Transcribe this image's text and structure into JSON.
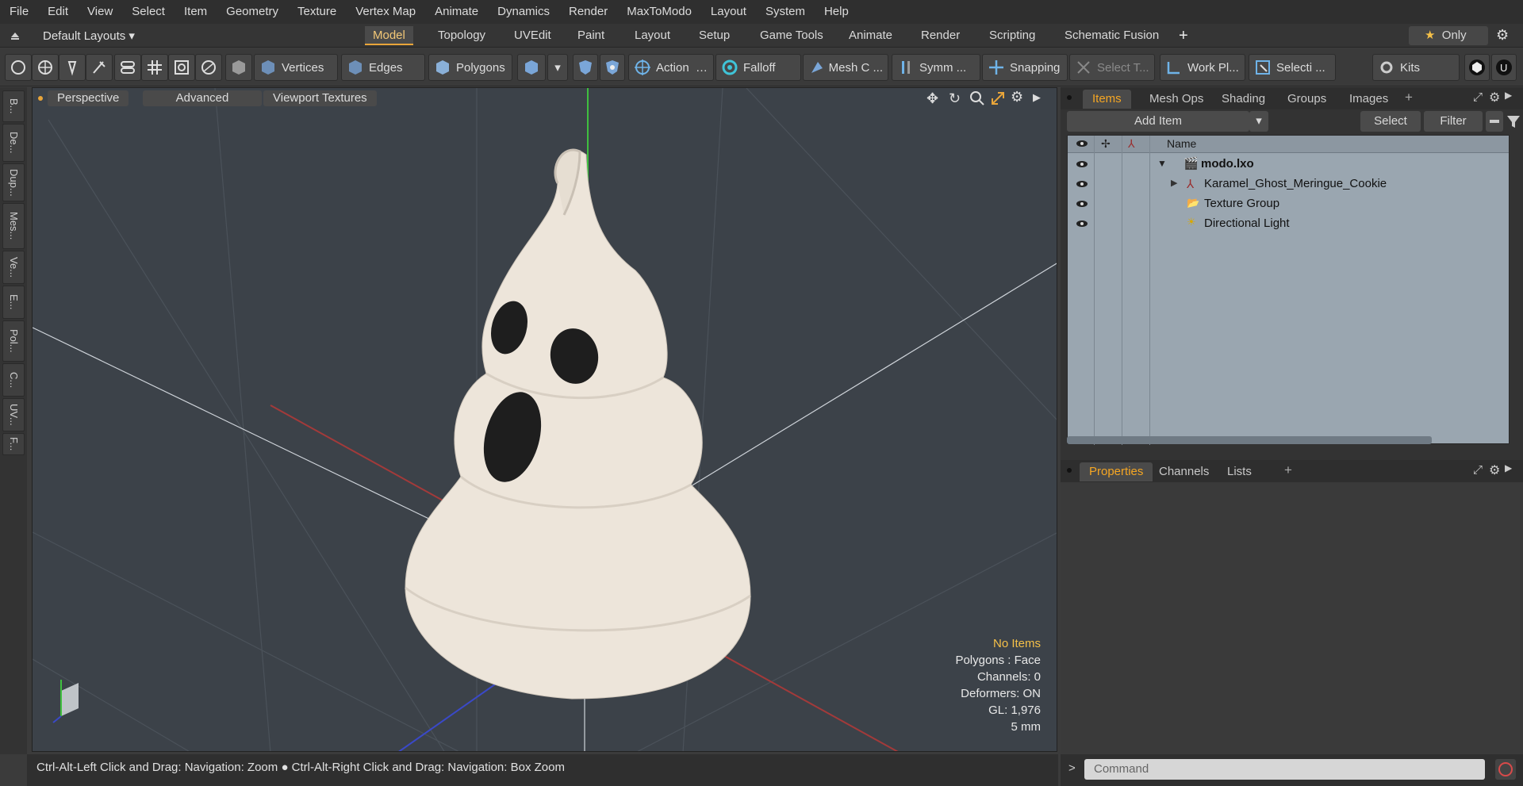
{
  "menu": [
    "File",
    "Edit",
    "View",
    "Select",
    "Item",
    "Geometry",
    "Texture",
    "Vertex Map",
    "Animate",
    "Dynamics",
    "Render",
    "MaxToModo",
    "Layout",
    "System",
    "Help"
  ],
  "layout_bar": {
    "layouts_label": "Default Layouts",
    "tabs": [
      "Model",
      "Topology",
      "UVEdit",
      "Paint",
      "Layout",
      "Setup",
      "Game Tools",
      "Animate",
      "Render",
      "Scripting",
      "Schematic Fusion"
    ],
    "active_tab": "Model",
    "only_label": "Only"
  },
  "toolbar": {
    "vertices": "Vertices",
    "edges": "Edges",
    "polygons": "Polygons",
    "action": "Action",
    "falloff": "Falloff",
    "mesh": "Mesh C ...",
    "symm": "Symm ...",
    "snapping": "Snapping",
    "select_t": "Select T...",
    "work_pl": "Work Pl...",
    "selecti": "Selecti ...",
    "kits": "Kits"
  },
  "left_tabs": [
    "B...",
    "De...",
    "Dup...",
    "Mes...",
    "Ve...",
    "E...",
    "Pol...",
    "C...",
    "UV...",
    "F..."
  ],
  "viewport": {
    "perspective": "Perspective",
    "advanced": "Advanced",
    "textures": "Viewport Textures",
    "info": {
      "no_items": "No Items",
      "polygons": "Polygons : Face",
      "channels": "Channels: 0",
      "deformers": "Deformers: ON",
      "gl": "GL: 1,976",
      "unit": "5 mm"
    }
  },
  "status": "Ctrl-Alt-Left Click and Drag: Navigation: Zoom ● Ctrl-Alt-Right Click and Drag: Navigation: Box Zoom",
  "items_panel": {
    "tabs": [
      "Items",
      "Mesh Ops",
      "Shading",
      "Groups",
      "Images"
    ],
    "active_tab": "Items",
    "add_item": "Add Item",
    "select": "Select",
    "filter": "Filter",
    "name_header": "Name",
    "rows": [
      {
        "label": "modo.lxo"
      },
      {
        "label": "Karamel_Ghost_Meringue_Cookie"
      },
      {
        "label": "Texture Group"
      },
      {
        "label": "Directional Light"
      }
    ]
  },
  "properties_panel": {
    "tabs": [
      "Properties",
      "Channels",
      "Lists"
    ],
    "active_tab": "Properties"
  },
  "command": {
    "placeholder": "Command"
  },
  "colors": {
    "accent": "#e8a53a",
    "viewport_bg": "#3c4249",
    "list_bg": "#9aa6b0"
  }
}
